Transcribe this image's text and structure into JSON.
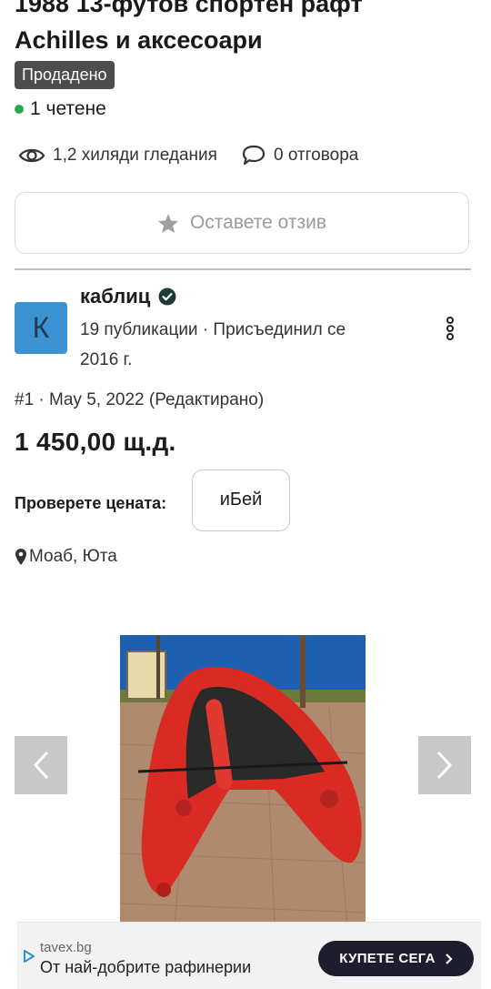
{
  "listing": {
    "title_line1": "1988 13-футов спортен рафт",
    "title_line2": "Achilles и аксесоари",
    "status_badge": "Продадено",
    "reads": "1 четене"
  },
  "stats": {
    "views": "1,2 хиляди гледания",
    "replies": "0 отговора"
  },
  "review_button_label": "Оставете отзив",
  "author": {
    "avatar_letter": "К",
    "name": "каблиц",
    "meta": "19 публикации · Присъединил се 2016 г."
  },
  "post": {
    "meta": "#1 · May 5, 2022 (Редактирано)",
    "price": "1 450,00 щ.д.",
    "check_price_label": "Проверете цената:",
    "ebay_label": "иБей",
    "location": "Моаб, Юта"
  },
  "ad": {
    "domain": "tavex.bg",
    "text": "От най-добрите рафинерии",
    "cta": "КУПЕТЕ СЕГА"
  },
  "colors": {
    "badge_bg": "#4d4d4d",
    "online_dot": "#2aa84a",
    "avatar_bg": "#3b94d1",
    "ad_cta_bg": "#1d1d2e"
  }
}
